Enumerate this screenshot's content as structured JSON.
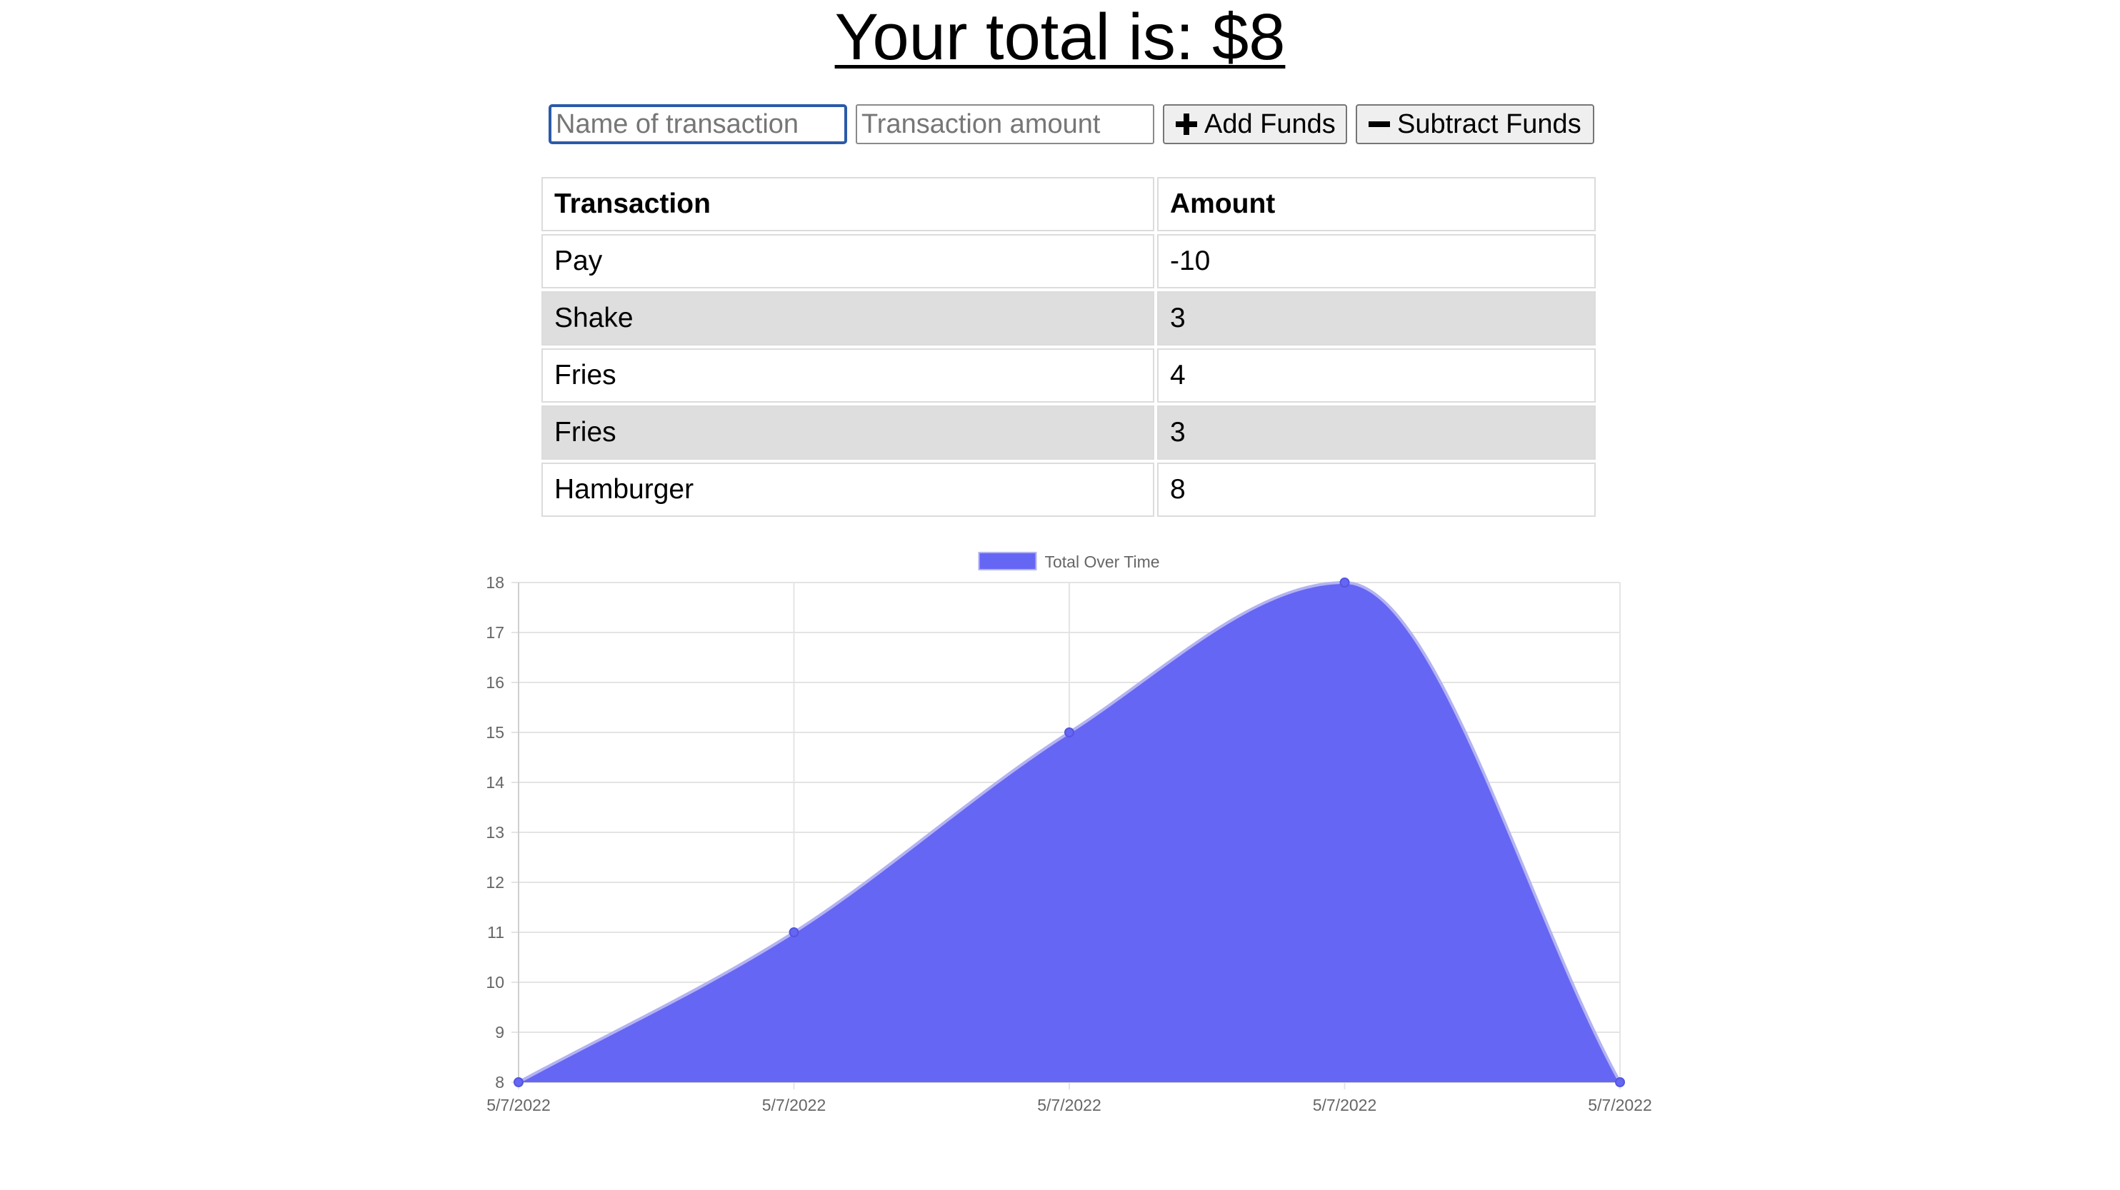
{
  "header": {
    "title": "Your total is: $8"
  },
  "form": {
    "name_placeholder": "Name of transaction",
    "amount_placeholder": "Transaction amount",
    "add_label": "Add Funds",
    "add_icon": "plus-icon",
    "subtract_label": "Subtract Funds",
    "subtract_icon": "minus-icon"
  },
  "table": {
    "headers": [
      "Transaction",
      "Amount"
    ],
    "rows": [
      {
        "name": "Pay",
        "amount": "-10"
      },
      {
        "name": "Shake",
        "amount": "3"
      },
      {
        "name": "Fries",
        "amount": "4"
      },
      {
        "name": "Fries",
        "amount": "3"
      },
      {
        "name": "Hamburger",
        "amount": "8"
      }
    ]
  },
  "chart_data": {
    "type": "area",
    "x": [
      "5/7/2022",
      "5/7/2022",
      "5/7/2022",
      "5/7/2022",
      "5/7/2022"
    ],
    "series": [
      {
        "name": "Total Over Time",
        "values": [
          8,
          11,
          15,
          18,
          8
        ],
        "color": "#6666f4"
      }
    ],
    "ylim": [
      8,
      18
    ],
    "yticks": [
      8,
      9,
      10,
      11,
      12,
      13,
      14,
      15,
      16,
      17,
      18
    ],
    "grid": true,
    "legend_position": "top"
  }
}
